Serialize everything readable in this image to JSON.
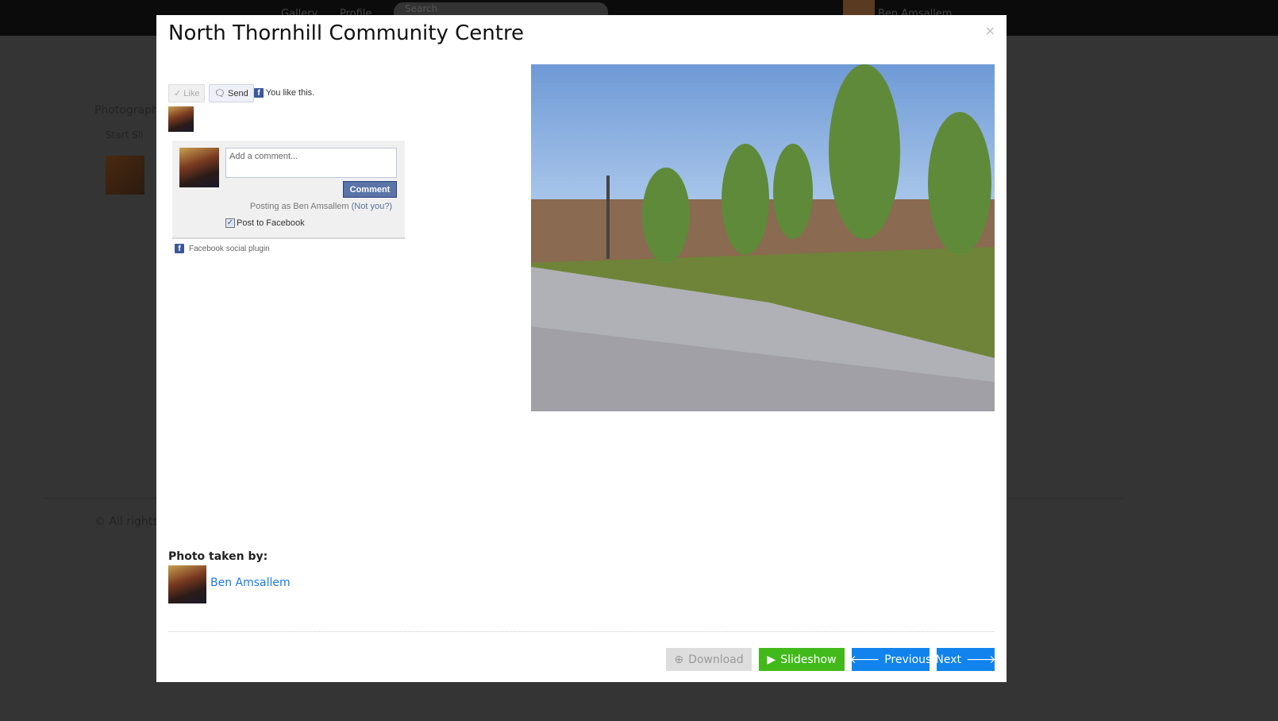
{
  "background": {
    "nav": [
      "Gallery",
      "Profile"
    ],
    "search_placeholder": "Search",
    "user": "Ben Amsallem",
    "section": "Photograph",
    "start_slideshow": "Start Sli",
    "footer": "© All rights"
  },
  "modal": {
    "title": "North Thornhill Community Centre",
    "close": "×",
    "facebook": {
      "like": "Like",
      "send": "Send",
      "likes_text": "You like this.",
      "comment_placeholder": "Add a comment...",
      "comment_button": "Comment",
      "posting_as": "Posting as Ben Amsallem",
      "not_you": "(Not you?)",
      "post_to_facebook": "Post to Facebook",
      "post_checked": true,
      "plugin": "Facebook social plugin"
    },
    "photo_taken_by_label": "Photo taken by:",
    "author": "Ben Amsallem",
    "buttons": {
      "download": "Download",
      "slideshow": "Slideshow",
      "previous": "Previous",
      "next": "Next"
    }
  },
  "colors": {
    "green": "#42b91b",
    "blue": "#1283ec",
    "facebook": "#3b5998"
  }
}
